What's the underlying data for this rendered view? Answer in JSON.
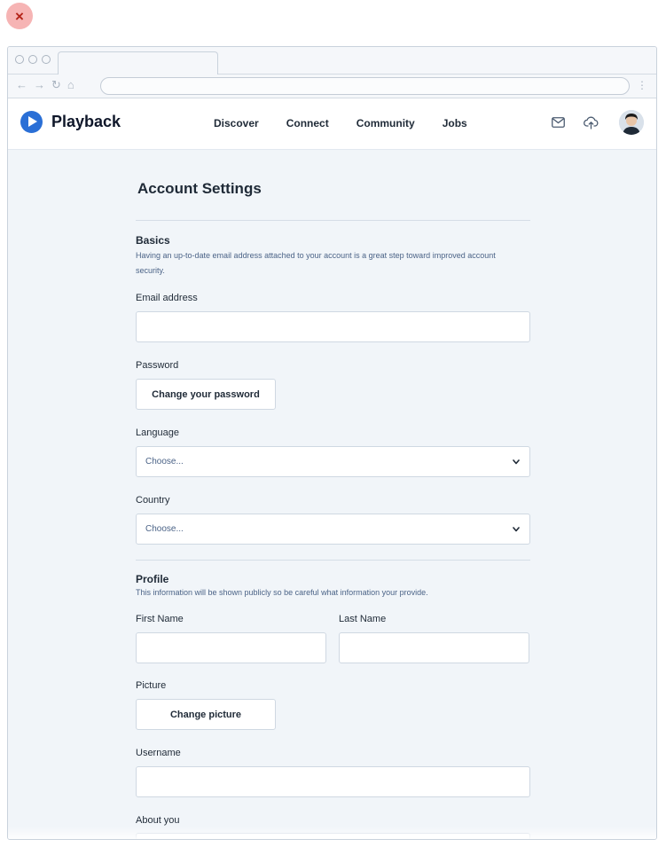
{
  "close_label": "×",
  "header": {
    "brand": "Playback",
    "nav": [
      "Discover",
      "Connect",
      "Community",
      "Jobs"
    ],
    "icons": [
      "mail-icon",
      "upload-cloud-icon"
    ],
    "avatar_alt": "user-avatar"
  },
  "page": {
    "title": "Account Settings"
  },
  "basics": {
    "title": "Basics",
    "description": "Having an up-to-date email address attached to your account is a great step toward improved account security.",
    "email_label": "Email address",
    "email_value": "",
    "password_label": "Password",
    "password_button": "Change your password",
    "language_label": "Language",
    "language_value": "Choose...",
    "country_label": "Country",
    "country_value": "Choose..."
  },
  "profile": {
    "title": "Profile",
    "description": "This information will be shown publicly so be careful what information your provide.",
    "first_name_label": "First Name",
    "last_name_label": "Last Name",
    "picture_label": "Picture",
    "picture_button": "Change picture",
    "username_label": "Username",
    "about_label": "About you"
  },
  "colors": {
    "brand": "#2a6fd6",
    "background": "#f1f5f9",
    "close": "#f6b4b4"
  }
}
